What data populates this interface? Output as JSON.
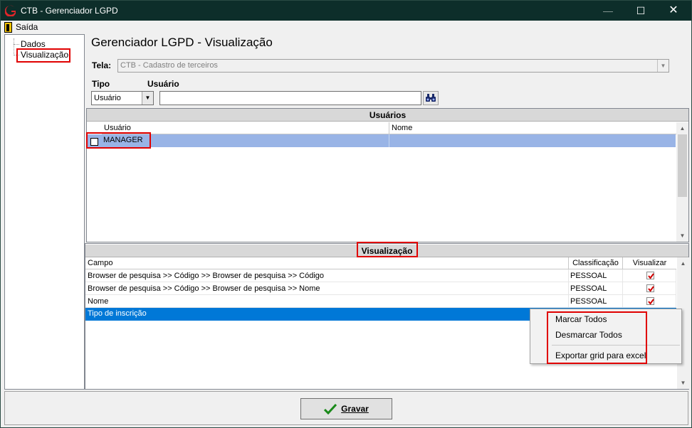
{
  "window": {
    "title": "CTB - Gerenciador LGPD",
    "minimize_glyph": "—",
    "maximize_glyph": "☐",
    "close_glyph": "✕"
  },
  "menubar": {
    "exit_label": "Saída"
  },
  "tree": {
    "items": [
      {
        "label": "Dados"
      },
      {
        "label": "Visualização"
      }
    ]
  },
  "header": {
    "title": "Gerenciador LGPD - Visualização"
  },
  "form": {
    "tela_label": "Tela:",
    "tela_value": "CTB - Cadastro de terceiros",
    "tipo_label": "Tipo",
    "tipo_value": "Usuário",
    "usuario_label": "Usuário",
    "usuario_value": ""
  },
  "users_panel": {
    "title": "Usuários",
    "columns": [
      "Usuário",
      "Nome"
    ],
    "rows": [
      {
        "usuario": "MANAGER",
        "nome": ""
      }
    ]
  },
  "view_panel": {
    "title": "Visualização",
    "columns": [
      "Campo",
      "Classificação",
      "Visualizar"
    ],
    "rows": [
      {
        "campo": "Browser de pesquisa >> Código >> Browser de pesquisa >> Código",
        "classificacao": "PESSOAL",
        "visualizar": true
      },
      {
        "campo": "Browser de pesquisa >> Código >> Browser de pesquisa >> Nome",
        "classificacao": "PESSOAL",
        "visualizar": true
      },
      {
        "campo": "Nome",
        "classificacao": "PESSOAL",
        "visualizar": true
      },
      {
        "campo": "Tipo de inscrição",
        "classificacao": "",
        "visualizar": false
      }
    ]
  },
  "context_menu": {
    "items": [
      "Marcar Todos",
      "Desmarcar Todos",
      "Exportar grid para excel"
    ]
  },
  "footer": {
    "save_label": "Gravar"
  },
  "colors": {
    "titlebar": "#0d2e2a",
    "selection_user_row": "#99b4e6",
    "selection_view_row": "#0078d7",
    "highlight_box": "#e00000",
    "check_mark": "#d00000"
  },
  "icons": [
    "app-logo-icon",
    "exit-icon",
    "binoculars-icon",
    "checkmark-icon",
    "dropdown-arrow-icon",
    "scroll-up-icon",
    "scroll-down-icon"
  ]
}
